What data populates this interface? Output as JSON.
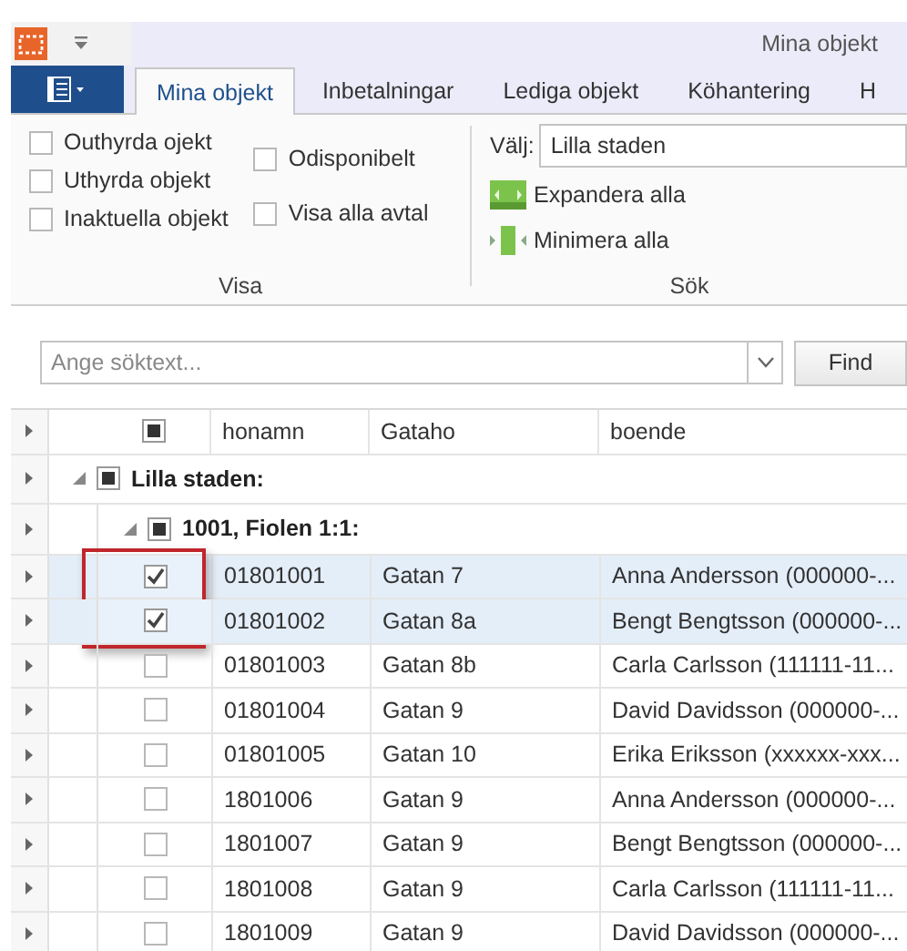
{
  "window": {
    "title": "Mina objekt"
  },
  "tabs": [
    {
      "label": "Mina objekt",
      "selected": true
    },
    {
      "label": "Inbetalningar",
      "selected": false
    },
    {
      "label": "Lediga objekt",
      "selected": false
    },
    {
      "label": "Köhantering",
      "selected": false
    },
    {
      "label": "H",
      "selected": false
    }
  ],
  "ribbon": {
    "visa": {
      "label": "Visa",
      "filter_columns": [
        [
          {
            "label": "Outhyrda ojekt",
            "checked": false
          },
          {
            "label": "Uthyrda objekt",
            "checked": false
          },
          {
            "label": "Inaktuella objekt",
            "checked": false
          }
        ],
        [
          {
            "label": "Odisponibelt",
            "checked": false
          },
          {
            "label": "Visa alla avtal",
            "checked": false
          }
        ]
      ]
    },
    "sok": {
      "label": "Sök",
      "select_label": "Välj:",
      "select_value": "Lilla staden",
      "actions": [
        {
          "kind": "expand",
          "label": "Expandera alla"
        },
        {
          "kind": "collapse",
          "label": "Minimera alla"
        }
      ]
    }
  },
  "search": {
    "placeholder": "Ange söktext...",
    "button": "Find"
  },
  "grid": {
    "header_partial": true,
    "columns": [
      "honamn",
      "Gataho",
      "boende"
    ],
    "groups": [
      {
        "label": "Lilla staden:",
        "expanded": true,
        "partial": true,
        "children": [
          {
            "label": "1001, Fiolen 1:1:",
            "expanded": true,
            "partial": true,
            "rows": [
              {
                "selected": true,
                "checked": true,
                "highlighted": true,
                "cells": [
                  "01801001",
                  "Gatan 7",
                  "Anna Andersson (000000-..."
                ]
              },
              {
                "selected": true,
                "checked": true,
                "highlighted": true,
                "cells": [
                  "01801002",
                  "Gatan 8a",
                  "Bengt Bengtsson (000000-..."
                ]
              },
              {
                "selected": false,
                "checked": false,
                "cells": [
                  "01801003",
                  "Gatan 8b",
                  "Carla Carlsson (111111-11..."
                ]
              },
              {
                "selected": false,
                "checked": false,
                "cells": [
                  "01801004",
                  "Gatan 9",
                  "David Davidsson (000000-..."
                ]
              },
              {
                "selected": false,
                "checked": false,
                "cells": [
                  "01801005",
                  "Gatan 10",
                  "Erika Eriksson (xxxxxx-xxx..."
                ]
              },
              {
                "selected": false,
                "checked": false,
                "cells": [
                  "1801006",
                  "Gatan 9",
                  "Anna Andersson (000000-..."
                ]
              },
              {
                "selected": false,
                "checked": false,
                "cells": [
                  "1801007",
                  "Gatan 9",
                  "Bengt Bengtsson (000000-..."
                ]
              },
              {
                "selected": false,
                "checked": false,
                "cells": [
                  "1801008",
                  "Gatan 9",
                  "Carla Carlsson (111111-11..."
                ]
              },
              {
                "selected": false,
                "checked": false,
                "cells": [
                  "1801009",
                  "Gatan 9",
                  "David Davidsson (000000-..."
                ]
              }
            ]
          }
        ]
      }
    ]
  }
}
